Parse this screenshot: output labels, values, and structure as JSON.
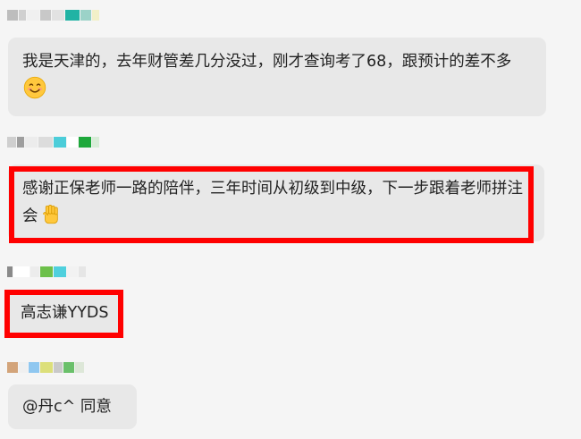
{
  "messages": [
    {
      "text": "我是天津的，去年财管差几分没过，刚才查询考了68，跟预计的差不多",
      "emoji": "smiling-face"
    },
    {
      "text": "感谢正保老师一路的陪伴，三年时间从初级到中级，下一步跟着老师拼注会",
      "emoji": "raised-fist"
    },
    {
      "text": "高志谦YYDS"
    },
    {
      "text": "@丹c^  同意"
    }
  ],
  "colors": {
    "background": "#f5f5f5",
    "bubble": "#e8e8e8",
    "highlight": "#ff0000"
  }
}
